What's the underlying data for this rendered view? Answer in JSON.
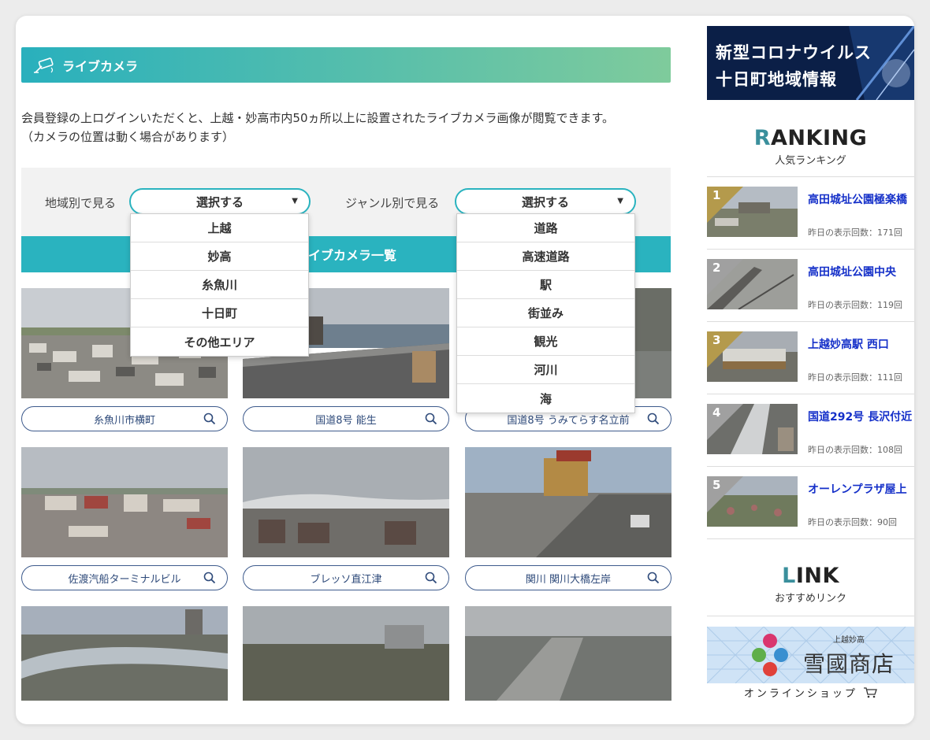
{
  "header": {
    "title": "ライブカメラ"
  },
  "description": {
    "line1": "会員登録の上ログインいただくと、上越・妙高市内50ヵ所以上に設置されたライブカメラ画像が閲覧できます。",
    "line2": "（カメラの位置は動く場合があります）"
  },
  "filters": {
    "region": {
      "label": "地域別で見る",
      "selected": "選択する",
      "options": [
        "上越",
        "妙高",
        "糸魚川",
        "十日町",
        "その他エリア"
      ]
    },
    "genre": {
      "label": "ジャンル別で見る",
      "selected": "選択する",
      "options": [
        "道路",
        "高速道路",
        "駅",
        "街並み",
        "観光",
        "河川",
        "海"
      ]
    }
  },
  "list_title": "ライブカメラ一覧",
  "cameras": [
    {
      "name": "糸魚川市横町"
    },
    {
      "name": "国道8号 能生"
    },
    {
      "name": "国道8号 うみてらす名立前"
    },
    {
      "name": "佐渡汽船ターミナルビル"
    },
    {
      "name": "ブレッソ直江津"
    },
    {
      "name": "関川 関川大橋左岸"
    }
  ],
  "sidebar": {
    "banner": {
      "line1": "新型コロナウイルス",
      "line2": "十日町地域情報"
    },
    "ranking": {
      "title_first": "R",
      "title_rest": "ANKING",
      "subtitle": "人気ランキング",
      "items": [
        {
          "rank": "1",
          "title": "高田城址公園極楽橋",
          "views": "昨日の表示回数：171回"
        },
        {
          "rank": "2",
          "title": "高田城址公園中央",
          "views": "昨日の表示回数：119回"
        },
        {
          "rank": "3",
          "title": "上越妙高駅 西口",
          "views": "昨日の表示回数：111回"
        },
        {
          "rank": "4",
          "title": "国道292号 長沢付近",
          "views": "昨日の表示回数：108回"
        },
        {
          "rank": "5",
          "title": "オーレンプラザ屋上",
          "views": "昨日の表示回数：90回"
        }
      ]
    },
    "link": {
      "title_first": "L",
      "title_rest": "INK",
      "subtitle": "おすすめリンク"
    },
    "shop": {
      "small": "上越妙高",
      "name": "雪國商店",
      "online": "オンラインショップ"
    }
  }
}
